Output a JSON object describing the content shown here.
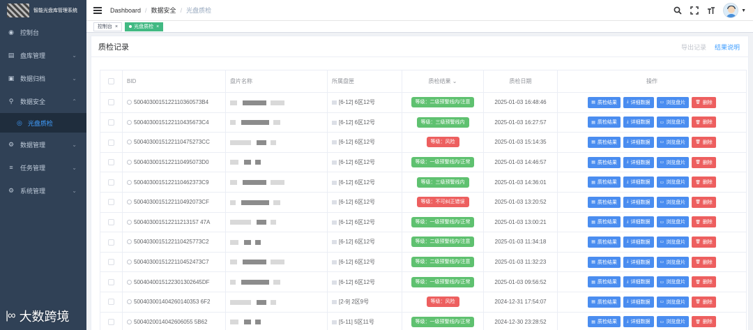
{
  "app": {
    "title": "智能光盘库管理系统"
  },
  "sidebar": {
    "items": [
      {
        "label": "控制台",
        "icon": "dashboard-icon",
        "glyph": "◉",
        "expandable": false
      },
      {
        "label": "盘库管理",
        "icon": "library-icon",
        "glyph": "▤",
        "expandable": true
      },
      {
        "label": "数据归档",
        "icon": "archive-icon",
        "glyph": "▣",
        "expandable": true
      },
      {
        "label": "数据安全",
        "icon": "security-icon",
        "glyph": "⚲",
        "expandable": true,
        "open": true
      },
      {
        "label": "数据管理",
        "icon": "data-icon",
        "glyph": "⚙",
        "expandable": true
      },
      {
        "label": "任务管理",
        "icon": "task-icon",
        "glyph": "≡",
        "expandable": true
      },
      {
        "label": "系统管理",
        "icon": "system-icon",
        "glyph": "⚙",
        "expandable": true
      }
    ],
    "active_sub": {
      "label": "光盘质检",
      "icon": "disc-icon",
      "glyph": "◎"
    }
  },
  "header": {
    "breadcrumb": [
      "Dashboard",
      "数据安全",
      "光盘质检"
    ]
  },
  "tags": [
    {
      "label": "控制台",
      "active": false
    },
    {
      "label": "光盘质检",
      "active": true
    }
  ],
  "card": {
    "title": "质检记录",
    "export_label": "导出记录",
    "explain_label": "结果说明"
  },
  "table": {
    "headers": {
      "bid": "BID",
      "name": "盘片名称",
      "location": "所属盘匣",
      "result": "质检结果",
      "date": "质检日期",
      "ops": "操作"
    },
    "op_labels": {
      "result": "质检结果",
      "detail": "详细数据",
      "browse": "浏览盘片",
      "delete": "删除"
    },
    "rows": [
      {
        "bid": "5004030015122110360573B4",
        "location": "[6-12] 6区12号",
        "result": "等级：二级预警线内/注意",
        "status": "green",
        "date": "2025-01-03 16:48:46",
        "blur": [
          0,
          0,
          0
        ]
      },
      {
        "bid": "5004030015122110435673C4",
        "location": "[6-12] 6区12号",
        "result": "等级：三级预警线内",
        "status": "green",
        "date": "2025-01-03 16:27:57",
        "blur": [
          1,
          2,
          3
        ]
      },
      {
        "bid": "5004030015122110475273CC",
        "location": "[6-12] 6区12号",
        "result": "等级：风险",
        "status": "red",
        "date": "2025-01-03 15:14:35",
        "blur": [
          0,
          1,
          2
        ]
      },
      {
        "bid": "5004030015122110495073D0",
        "location": "[6-12] 6区12号",
        "result": "等级：一级预警线内/正常",
        "status": "green",
        "date": "2025-01-03 14:46:57",
        "blur": [
          1,
          0,
          2
        ]
      },
      {
        "bid": "5004030015122110462373C9",
        "location": "[6-12] 6区12号",
        "result": "等级：三级预警线内",
        "status": "green",
        "date": "2025-01-03 14:36:01",
        "blur": [
          0,
          2,
          1
        ]
      },
      {
        "bid": "5004030015122110492073CF",
        "location": "[6-12] 6区12号",
        "result": "等级：不可纠正错误",
        "status": "red",
        "date": "2025-01-03 13:20:52",
        "blur": [
          1,
          1,
          0
        ]
      },
      {
        "bid": "500403001512211213157 47A",
        "location": "[6-12] 6区12号",
        "result": "等级：一级预警线内/正常",
        "status": "green",
        "date": "2025-01-03 13:00:21",
        "blur": [
          2,
          1,
          0
        ]
      },
      {
        "bid": "5004030015122110425773C2",
        "location": "[6-12] 6区12号",
        "result": "等级：二级预警线内/注意",
        "status": "green",
        "date": "2025-01-03 11:34:18",
        "blur": [
          0,
          1,
          3
        ]
      },
      {
        "bid": "5004030015122110452473C7",
        "location": "[6-12] 6区12号",
        "result": "等级：二级预警线内/注意",
        "status": "green",
        "date": "2025-01-03 11:32:23",
        "blur": [
          1,
          2,
          0
        ]
      },
      {
        "bid": "5004040015122301302645DF",
        "location": "[6-12] 6区12号",
        "result": "等级：一级预警线内/正常",
        "status": "green",
        "date": "2025-01-03 09:56:52",
        "blur": [
          0,
          2,
          1
        ]
      },
      {
        "bid": "500403001404260140353 6F2",
        "location": "[2-9] 2区9号",
        "result": "等级：风险",
        "status": "red",
        "date": "2024-12-31 17:54:07",
        "blur": [
          1,
          0,
          1
        ]
      },
      {
        "bid": "5004020014042606055 5B62",
        "location": "[5-11] 5区11号",
        "result": "等级：一级预警线内/正常",
        "status": "green",
        "date": "2024-12-30 23:28:52",
        "blur": [
          0,
          1,
          2
        ]
      }
    ]
  },
  "watermark": {
    "logo": "|∞",
    "text": "大数跨境"
  }
}
